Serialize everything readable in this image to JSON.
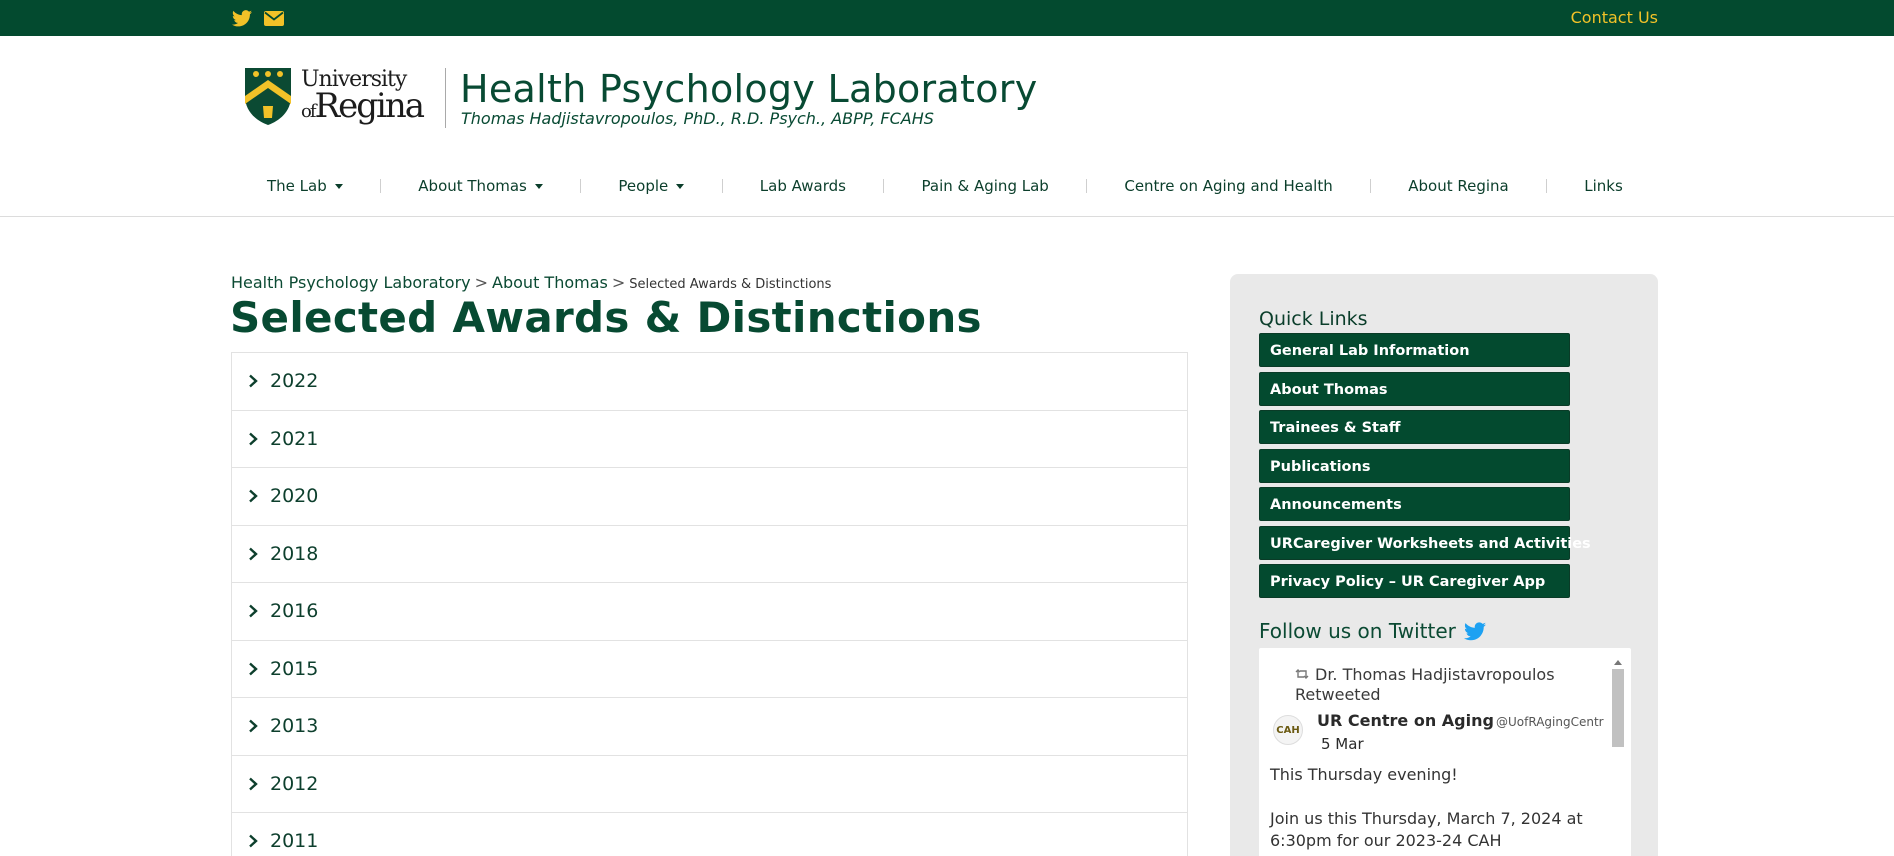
{
  "topbar": {
    "icons": [
      "twitter-icon",
      "envelope-icon"
    ],
    "contact_label": "Contact Us"
  },
  "header": {
    "logo_univ": "University",
    "logo_of": "of",
    "logo_regina": "Regina",
    "title": "Health Psychology Laboratory",
    "subtitle": "Thomas Hadjistavropoulos, PhD., R.D. Psych., ABPP, FCAHS"
  },
  "nav": {
    "items": [
      {
        "label": "The Lab"
      },
      {
        "label": "About Thomas"
      },
      {
        "label": "People"
      },
      {
        "label": "Lab Awards"
      },
      {
        "label": "Pain & Aging Lab"
      },
      {
        "label": "Centre on Aging and Health"
      },
      {
        "label": "About Regina"
      },
      {
        "label": "Links"
      }
    ]
  },
  "breadcrumb": {
    "home": "Health Psychology Laboratory",
    "parent": "About Thomas",
    "separator": ">",
    "current": "Selected Awards & Distinctions"
  },
  "main": {
    "title": "Selected Awards & Distinctions",
    "years": [
      "2022",
      "2021",
      "2020",
      "2018",
      "2016",
      "2015",
      "2013",
      "2012",
      "2011"
    ]
  },
  "sidebar": {
    "quick_links_title": "Quick Links",
    "quick_links": [
      "General Lab Information",
      "About Thomas",
      "Trainees & Staff",
      "Publications",
      "Announcements",
      "URCaregiver Worksheets and Activities",
      "Privacy Policy – UR Caregiver App"
    ],
    "twitter_title": "Follow us on Twitter",
    "tweet": {
      "retweeted_by": "Dr. Thomas Hadjistavropoulos Retweeted",
      "avatar_text": "CAH",
      "name": "UR Centre on Aging",
      "handle": "@UofRAgingCentr",
      "date": "5 Mar",
      "text_line1": "This Thursday evening!",
      "text_line2": "Join us this Thursday, March 7, 2024 at 6:30pm for our 2023-24 CAH"
    }
  },
  "colors": {
    "brand_green": "#034a2f",
    "accent_gold": "#f2c228",
    "twitter_blue": "#1da1f2"
  }
}
